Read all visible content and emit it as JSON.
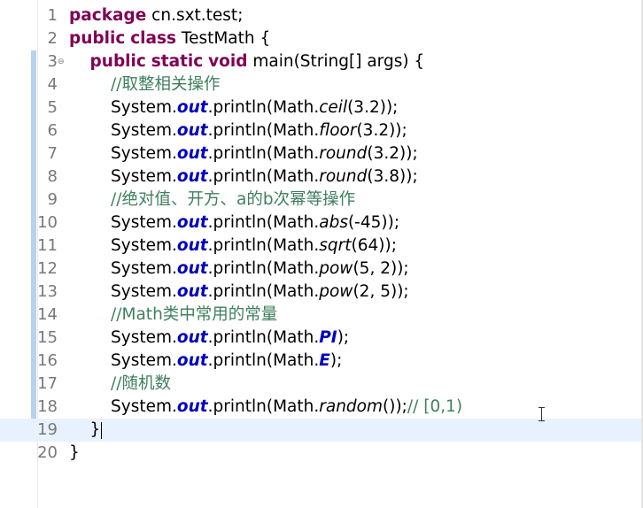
{
  "editor": {
    "current_line": 19,
    "lines": [
      {
        "n": "1",
        "tokens": [
          {
            "t": "package",
            "c": "kw"
          },
          {
            "t": " cn.sxt.test;"
          }
        ]
      },
      {
        "n": "2",
        "tokens": [
          {
            "t": "public",
            "c": "kw"
          },
          {
            "t": " "
          },
          {
            "t": "class",
            "c": "kw"
          },
          {
            "t": " TestMath {"
          }
        ]
      },
      {
        "n": "3",
        "fold": true,
        "tokens": [
          {
            "t": "    "
          },
          {
            "t": "public",
            "c": "kw"
          },
          {
            "t": " "
          },
          {
            "t": "static",
            "c": "kw"
          },
          {
            "t": " "
          },
          {
            "t": "void",
            "c": "kw"
          },
          {
            "t": " main(String[] args) {"
          }
        ]
      },
      {
        "n": "4",
        "tokens": [
          {
            "t": "        "
          },
          {
            "t": "//取整相关操作",
            "c": "cm"
          }
        ]
      },
      {
        "n": "5",
        "tokens": [
          {
            "t": "        System."
          },
          {
            "t": "out",
            "c": "fld"
          },
          {
            "t": ".println(Math."
          },
          {
            "t": "ceil",
            "c": "sm"
          },
          {
            "t": "(3.2));"
          }
        ]
      },
      {
        "n": "6",
        "tokens": [
          {
            "t": "        System."
          },
          {
            "t": "out",
            "c": "fld"
          },
          {
            "t": ".println(Math."
          },
          {
            "t": "floor",
            "c": "sm"
          },
          {
            "t": "(3.2));"
          }
        ]
      },
      {
        "n": "7",
        "tokens": [
          {
            "t": "        System."
          },
          {
            "t": "out",
            "c": "fld"
          },
          {
            "t": ".println(Math."
          },
          {
            "t": "round",
            "c": "sm"
          },
          {
            "t": "(3.2));"
          }
        ]
      },
      {
        "n": "8",
        "tokens": [
          {
            "t": "        System."
          },
          {
            "t": "out",
            "c": "fld"
          },
          {
            "t": ".println(Math."
          },
          {
            "t": "round",
            "c": "sm"
          },
          {
            "t": "(3.8));"
          }
        ]
      },
      {
        "n": "9",
        "tokens": [
          {
            "t": "        "
          },
          {
            "t": "//绝对值、开方、a的b次幂等操作",
            "c": "cm"
          }
        ]
      },
      {
        "n": "10",
        "tokens": [
          {
            "t": "        System."
          },
          {
            "t": "out",
            "c": "fld"
          },
          {
            "t": ".println(Math."
          },
          {
            "t": "abs",
            "c": "sm"
          },
          {
            "t": "(-45));"
          }
        ]
      },
      {
        "n": "11",
        "tokens": [
          {
            "t": "        System."
          },
          {
            "t": "out",
            "c": "fld"
          },
          {
            "t": ".println(Math."
          },
          {
            "t": "sqrt",
            "c": "sm"
          },
          {
            "t": "(64));"
          }
        ]
      },
      {
        "n": "12",
        "tokens": [
          {
            "t": "        System."
          },
          {
            "t": "out",
            "c": "fld"
          },
          {
            "t": ".println(Math."
          },
          {
            "t": "pow",
            "c": "sm"
          },
          {
            "t": "(5, 2));"
          }
        ]
      },
      {
        "n": "13",
        "tokens": [
          {
            "t": "        System."
          },
          {
            "t": "out",
            "c": "fld"
          },
          {
            "t": ".println(Math."
          },
          {
            "t": "pow",
            "c": "sm"
          },
          {
            "t": "(2, 5));"
          }
        ]
      },
      {
        "n": "14",
        "tokens": [
          {
            "t": "        "
          },
          {
            "t": "//Math类中常用的常量",
            "c": "cm"
          }
        ]
      },
      {
        "n": "15",
        "tokens": [
          {
            "t": "        System."
          },
          {
            "t": "out",
            "c": "fld"
          },
          {
            "t": ".println(Math."
          },
          {
            "t": "PI",
            "c": "fld"
          },
          {
            "t": ");"
          }
        ]
      },
      {
        "n": "16",
        "tokens": [
          {
            "t": "        System."
          },
          {
            "t": "out",
            "c": "fld"
          },
          {
            "t": ".println(Math."
          },
          {
            "t": "E",
            "c": "fld"
          },
          {
            "t": ");"
          }
        ]
      },
      {
        "n": "17",
        "tokens": [
          {
            "t": "        "
          },
          {
            "t": "//随机数",
            "c": "cm"
          }
        ]
      },
      {
        "n": "18",
        "tokens": [
          {
            "t": "        System."
          },
          {
            "t": "out",
            "c": "fld"
          },
          {
            "t": ".println(Math."
          },
          {
            "t": "random",
            "c": "sm"
          },
          {
            "t": "());"
          },
          {
            "t": "// [0,1)",
            "c": "cm"
          }
        ]
      },
      {
        "n": "19",
        "tokens": [
          {
            "t": "    }"
          }
        ],
        "caret": true
      },
      {
        "n": "20",
        "tokens": [
          {
            "t": "}"
          }
        ]
      }
    ],
    "change_bars": [
      {
        "from": 3,
        "to": 18
      }
    ],
    "colors": {
      "keyword": "#7f0055",
      "static_field": "#0000c0",
      "comment": "#3f7f5f",
      "line_number": "#787878",
      "current_line_bg": "#e8f2fe",
      "change_bar": "#b6d2ee"
    },
    "icons": [
      "fold-collapse-icon",
      "text-cursor-icon"
    ]
  }
}
